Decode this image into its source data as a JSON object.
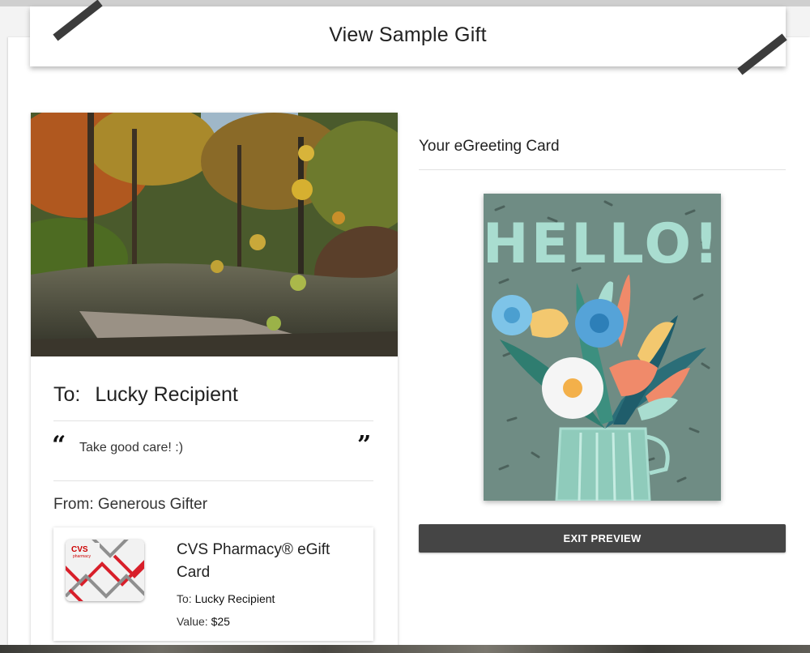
{
  "header": {
    "title": "View Sample Gift"
  },
  "message_card": {
    "to_label": "To:",
    "recipient": "Lucky Recipient",
    "open_quote": "“",
    "close_quote": "”",
    "message": "Take good care! :)",
    "from_text": "From: Generous Gifter"
  },
  "gift_card": {
    "logo_text": "CVS",
    "logo_subtext": "pharmacy",
    "name": "CVS Pharmacy® eGift Card",
    "to_label": "To:",
    "to_value": "Lucky Recipient",
    "value_label": "Value:",
    "value": "$25"
  },
  "preview": {
    "heading": "Your eGreeting Card",
    "card_text": "HELLO!",
    "exit_button": "EXIT PREVIEW"
  },
  "colors": {
    "greeting_bg": "#6f8c84",
    "greeting_text": "#a9ddd0",
    "button_bg": "#454545",
    "brand_red": "#cc0000"
  },
  "icons": {
    "open_quote": "open-quote-icon",
    "close_quote": "close-quote-icon"
  }
}
